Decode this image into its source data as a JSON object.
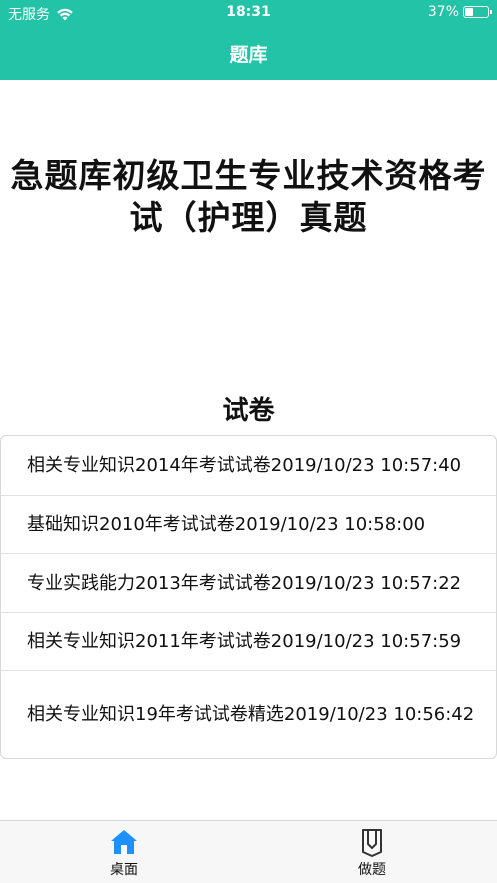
{
  "status_bar": {
    "carrier": "无服务",
    "time": "18:31",
    "battery": "37%"
  },
  "nav": {
    "title": "题库"
  },
  "main": {
    "title": "急题库初级卫生专业技术资格考试（护理）真题",
    "section_title": "试卷",
    "papers": [
      {
        "label": "相关专业知识2014年考试试卷2019/10/23 10:57:40"
      },
      {
        "label": "基础知识2010年考试试卷2019/10/23 10:58:00"
      },
      {
        "label": "专业实践能力2013年考试试卷2019/10/23 10:57:22"
      },
      {
        "label": "相关专业知识2011年考试试卷2019/10/23 10:57:59"
      },
      {
        "label": "相关专业知识19年考试试卷精选2019/10/23 10:56:42"
      }
    ]
  },
  "tabbar": {
    "tabs": [
      {
        "label": "桌面",
        "icon": "home-icon",
        "active": true
      },
      {
        "label": "做题",
        "icon": "bookmark-icon",
        "active": false
      }
    ]
  },
  "colors": {
    "accent": "#22c3a6",
    "tab_active": "#1e90ff"
  }
}
